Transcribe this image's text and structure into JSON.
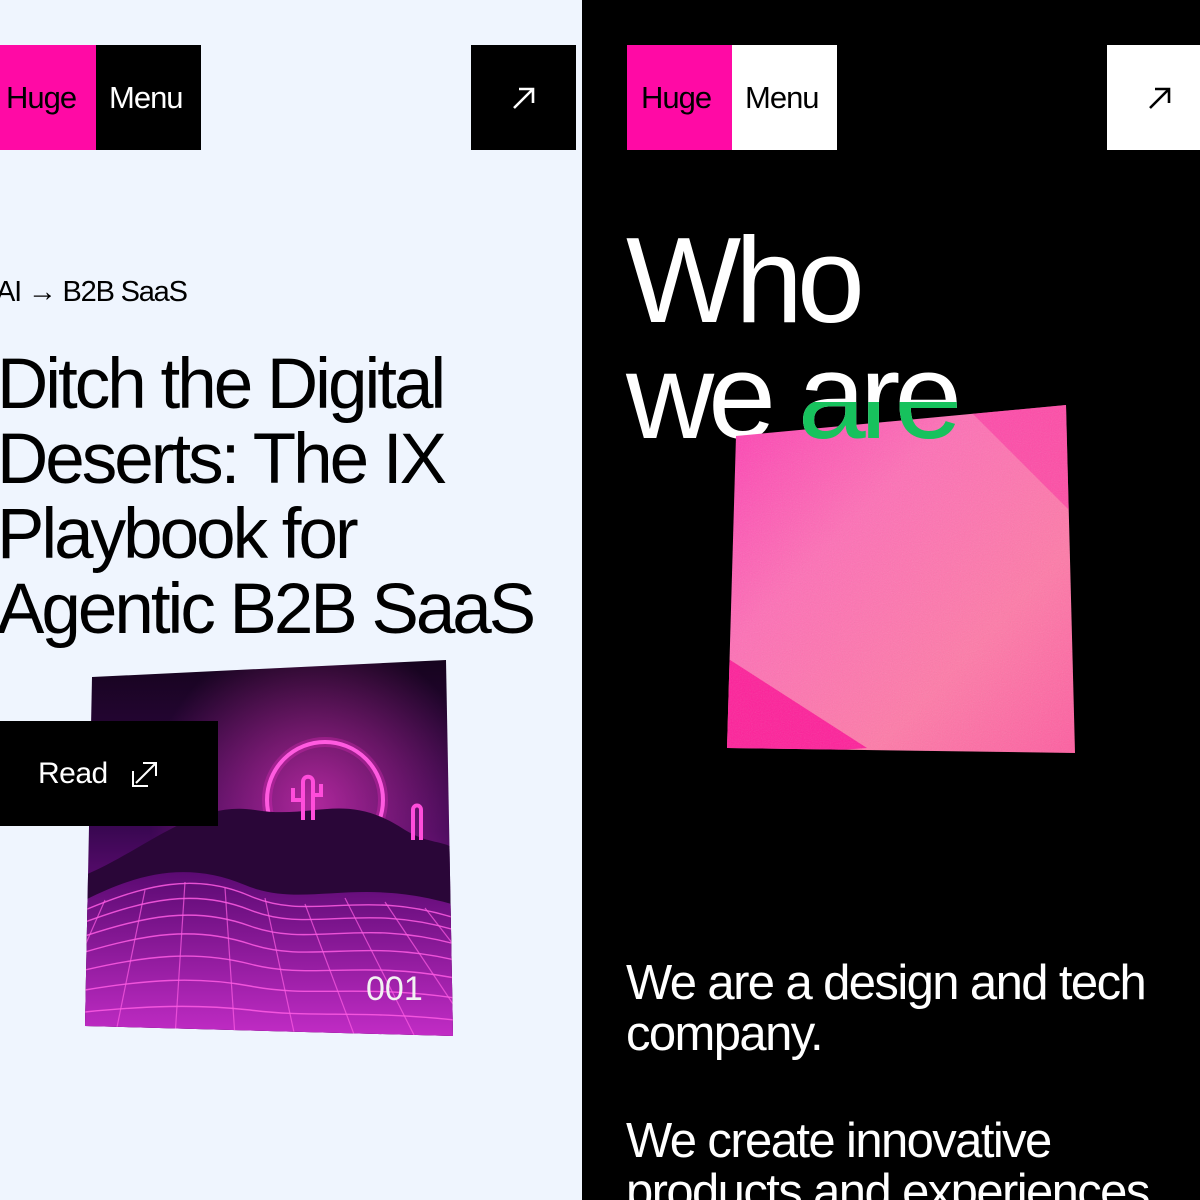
{
  "left": {
    "header": {
      "logo_label": "Huge",
      "menu_label": "Menu"
    },
    "eyebrow": "AI → B2B SaaS",
    "headline_lines": [
      "Ditch the Digital",
      "Deserts: The IX",
      "Playbook for",
      "Agentic B2B SaaS"
    ],
    "read_button_label": "Read",
    "card_number": "001",
    "colors": {
      "background": "#eff5fe",
      "brand_pink": "#ff0aa5"
    }
  },
  "right": {
    "header": {
      "logo_label": "Huge",
      "menu_label": "Menu"
    },
    "title_lines": [
      "Who",
      "we are"
    ],
    "intro_paragraphs": [
      "We are a design and tech company.",
      "We create innovative products and experiences"
    ],
    "colors": {
      "background": "#000000",
      "accent_green": "#17c25d"
    }
  },
  "icons": {
    "arrow": "arrow-up-right-icon",
    "read": "external-link-icon"
  }
}
